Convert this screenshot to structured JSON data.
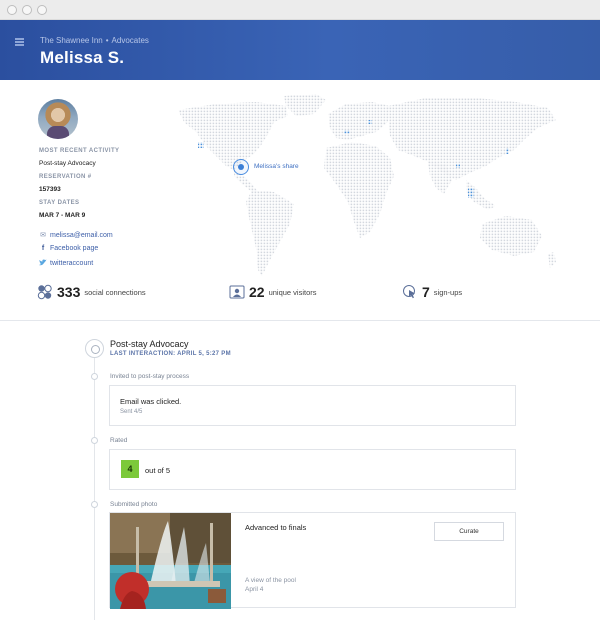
{
  "header": {
    "breadcrumb_venue": "The Shawnee Inn",
    "breadcrumb_separator": "•",
    "breadcrumb_section": "Advocates",
    "title": "Melissa S."
  },
  "profile": {
    "recent_activity_label": "MOST RECENT ACTIVITY",
    "recent_activity_value": "Post-stay Advocacy",
    "reservation_label": "RESERVATION #",
    "reservation_value": "157393",
    "stay_dates_label": "STAY DATES",
    "stay_dates_value": "MAR 7 - MAR 9",
    "email": "melissa@email.com",
    "facebook": "Facebook page",
    "twitter": "twitteraccount"
  },
  "map": {
    "share_label": "Melissa's share"
  },
  "stats": {
    "social_connections_count": "333",
    "social_connections_label": "social connections",
    "unique_visitors_count": "22",
    "unique_visitors_label": "unique visitors",
    "signups_count": "7",
    "signups_label": "sign-ups"
  },
  "timeline": {
    "title": "Post-stay Advocacy",
    "last_interaction": "LAST INTERACTION: APRIL 5, 5:27 PM",
    "steps": [
      {
        "label": "Invited to post-stay process",
        "card_text": "Email was clicked.",
        "card_sub": "Sent 4/5"
      },
      {
        "label": "Rated",
        "rating": "4",
        "rating_suffix": "out of 5"
      },
      {
        "label": "Submitted photo",
        "card_text": "Advanced to finals",
        "button": "Curate",
        "caption": "A view of the pool",
        "caption_date": "April 4"
      }
    ]
  },
  "colors": {
    "header": "#3a64b6",
    "accent_blue": "#3b7fd6",
    "rating_green": "#7cc93a"
  }
}
